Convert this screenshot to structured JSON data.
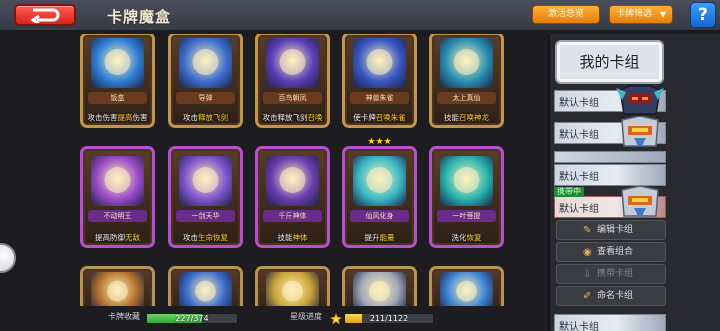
{
  "header": {
    "title": "卡牌魔盒",
    "overview_label": "激活总览",
    "filter_label": "卡牌筛选",
    "help_label": "?"
  },
  "cards_row1": [
    {
      "name": "饭盒",
      "skill_pre": "攻击伤害",
      "skill_hl": "提高",
      "skill_post": "伤害",
      "art": "#2f7fd8",
      "frame": "#c2954d"
    },
    {
      "name": "导弹",
      "skill_pre": "攻击",
      "skill_hl": "释放飞剑",
      "skill_post": "",
      "art": "#3f6fd0",
      "frame": "#c2954d"
    },
    {
      "name": "百鸟朝凤",
      "skill_pre": "攻击释放飞剑",
      "skill_hl": "召唤",
      "skill_post": "",
      "art": "#5c3fb8",
      "frame": "#c2954d"
    },
    {
      "name": "神兽朱雀",
      "skill_pre": "使卡牌",
      "skill_hl": "召唤朱雀",
      "skill_post": "",
      "art": "#3857c4",
      "frame": "#c2954d"
    },
    {
      "name": "太上真仙",
      "skill_pre": "技能",
      "skill_hl": "召唤神龙",
      "skill_post": "",
      "art": "#2b8fb4",
      "frame": "#c2954d"
    }
  ],
  "cards_row2": [
    {
      "name": "不动明王",
      "skill_pre": "提高防御",
      "skill_hl": "无敌",
      "skill_post": "",
      "art": "#9a4bc8",
      "frame": "#b64fd0"
    },
    {
      "name": "一剑天华",
      "skill_pre": "攻击",
      "skill_hl": "生命恢复",
      "skill_post": "",
      "art": "#7f55d0",
      "frame": "#b64fd0"
    },
    {
      "name": "千斤神体",
      "skill_pre": "技能",
      "skill_hl": "神体",
      "skill_post": "",
      "art": "#6a3db0",
      "frame": "#b64fd0"
    },
    {
      "name": "仙风化身",
      "skill_pre": "提升",
      "skill_hl": "能量",
      "skill_post": "",
      "art": "#3ab8c8",
      "frame": "#b64fd0"
    },
    {
      "name": "一叶菩提",
      "skill_pre": "洗化",
      "skill_hl": "恢复",
      "skill_post": "",
      "art": "#28b4b0",
      "frame": "#b64fd0"
    }
  ],
  "cards_row3": [
    {
      "art": "#b5742f"
    },
    {
      "art": "#3f6fd0"
    },
    {
      "art": "#c9a23a"
    },
    {
      "art": "#a0a8b8"
    },
    {
      "art": "#3f86d8"
    }
  ],
  "progress": {
    "collection_label": "卡牌收藏",
    "collection_text": "227/374",
    "collection_fraction": 0.607,
    "star_label": "星级进度",
    "star_text": "211/1122",
    "star_fraction": 0.188
  },
  "deck_panel": {
    "title": "我的卡组",
    "decks": [
      {
        "name": "默认卡组"
      },
      {
        "name": "默认卡组"
      },
      {
        "name": "默认卡组"
      },
      {
        "name": "默认卡组",
        "tag": "携带中"
      },
      {
        "name": "默认卡组"
      }
    ],
    "actions": [
      {
        "label": "编辑卡组",
        "icon": "edit-icon"
      },
      {
        "label": "查看组合",
        "icon": "view-icon"
      },
      {
        "label": "携带卡组",
        "icon": "carry-icon"
      },
      {
        "label": "命名卡组",
        "icon": "rename-icon"
      }
    ]
  },
  "colors": {
    "back_button": "#e02a20",
    "orange_button": "#f08a14",
    "help_button": "#1f73dc",
    "progress_fill": "#4cbd47"
  }
}
